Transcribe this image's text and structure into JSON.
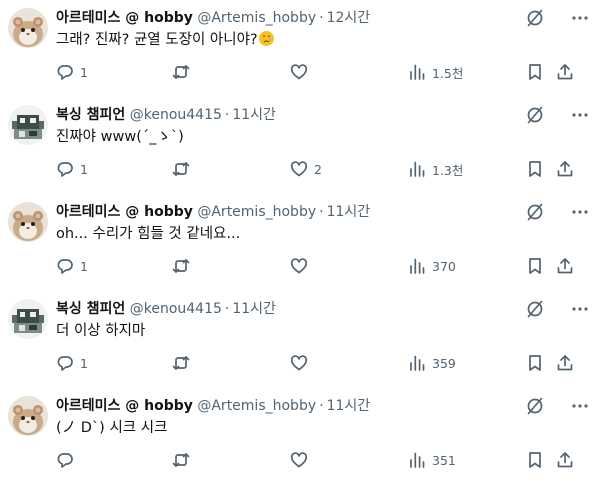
{
  "tweets": [
    {
      "author": "아르테미스 @ hobby",
      "handle": "@Artemis_hobby",
      "separator": "·",
      "time": "12시간",
      "avatar_icon": "hamster-avatar",
      "text": "그래? 진짜? 균열 도장이 아니야?",
      "emoji": "sad-tear-emoji",
      "replies": "1",
      "retweets": "",
      "likes": "",
      "views": "1.5천"
    },
    {
      "author": "복싱 챔피언",
      "handle": "@kenou4415",
      "separator": "·",
      "time": "11시간",
      "avatar_icon": "pixel-robot-avatar",
      "text": "진짜야 www(´_ゝ`)",
      "replies": "1",
      "retweets": "",
      "likes": "2",
      "views": "1.3천"
    },
    {
      "author": "아르테미스 @ hobby",
      "handle": "@Artemis_hobby",
      "separator": "·",
      "time": "11시간",
      "avatar_icon": "hamster-avatar",
      "text": "oh... 수리가 힘들 것 같네요...",
      "replies": "1",
      "retweets": "",
      "likes": "",
      "views": "370"
    },
    {
      "author": "복싱 챔피언",
      "handle": "@kenou4415",
      "separator": "·",
      "time": "11시간",
      "avatar_icon": "pixel-robot-avatar",
      "text": "더 이상 하지마",
      "replies": "1",
      "retweets": "",
      "likes": "",
      "views": "359"
    },
    {
      "author": "아르테미스 @ hobby",
      "handle": "@Artemis_hobby",
      "separator": "·",
      "time": "11시간",
      "avatar_icon": "hamster-avatar",
      "text": "(ノ D`) 시크 시크",
      "replies": "",
      "retweets": "",
      "likes": "",
      "views": "351"
    }
  ],
  "icons": {
    "grok": "grok-icon",
    "more": "more-icon",
    "reply": "reply-icon",
    "retweet": "retweet-icon",
    "like": "like-icon",
    "views": "views-icon",
    "bookmark": "bookmark-icon",
    "share": "share-icon"
  },
  "colors": {
    "text": "#0f1419",
    "secondary": "#536471",
    "background": "#ffffff"
  }
}
